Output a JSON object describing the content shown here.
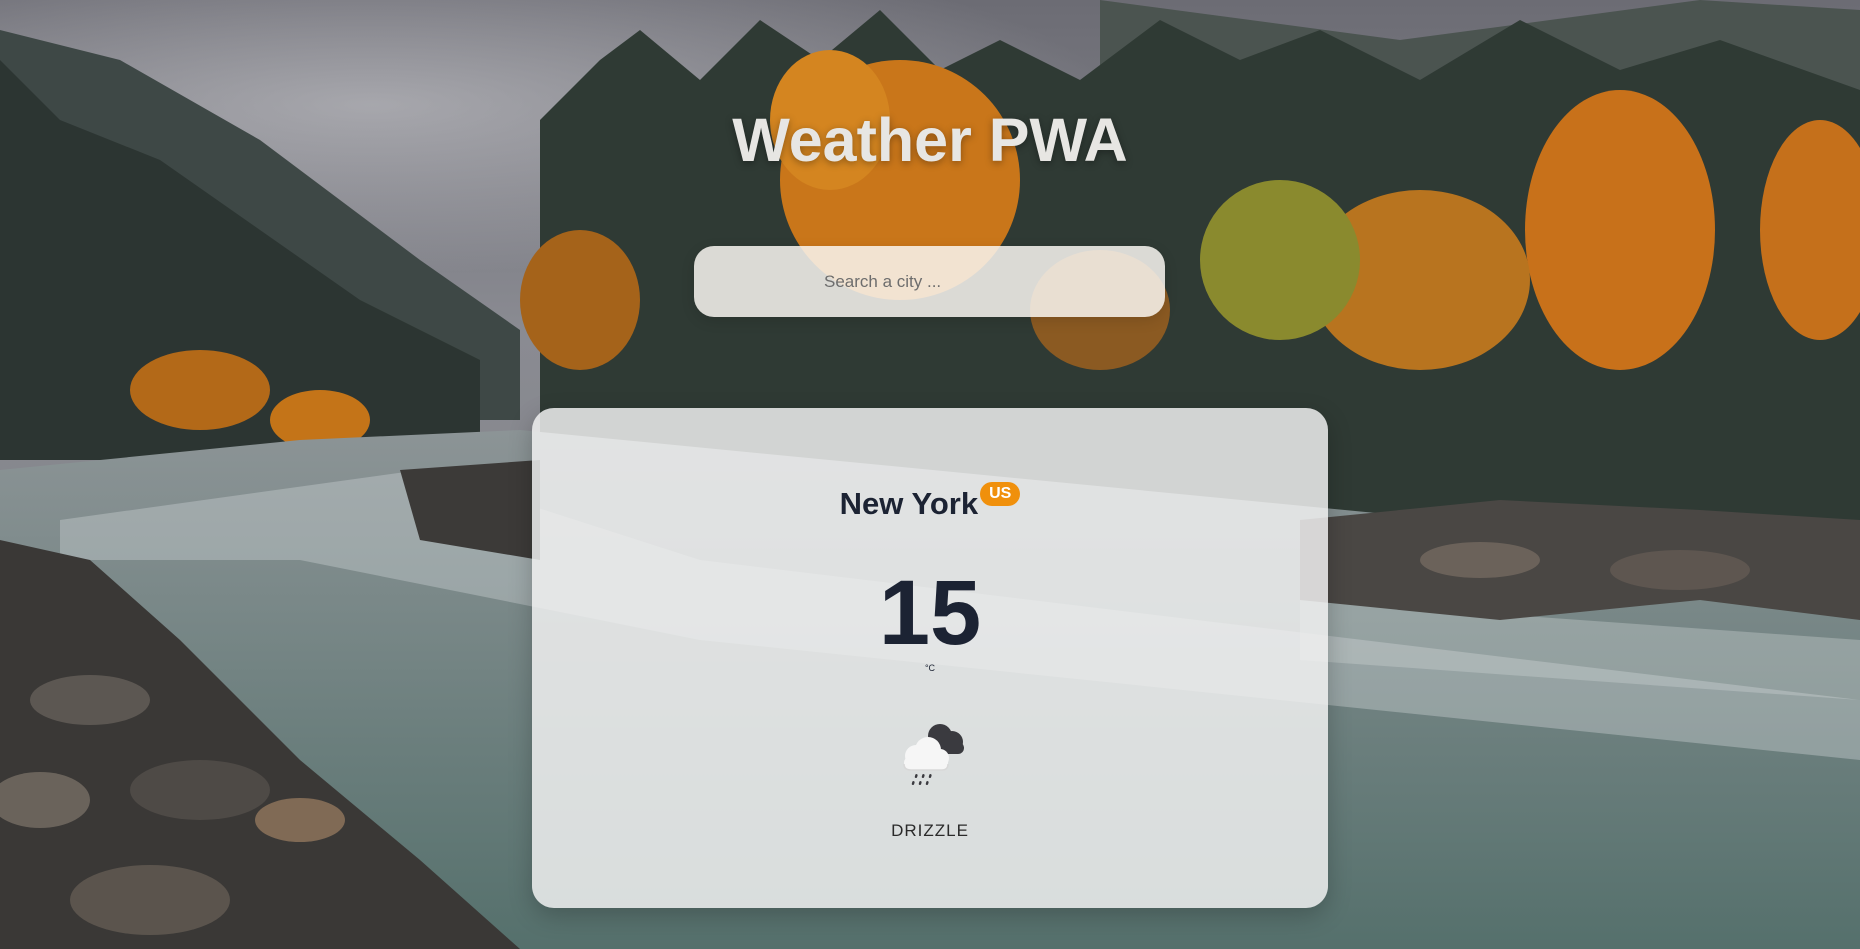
{
  "app": {
    "title": "Weather PWA"
  },
  "search": {
    "placeholder": "Search a city ...",
    "value": ""
  },
  "weather_card": {
    "city": "New York",
    "country_code": "US",
    "temperature": "15",
    "unit": "°C",
    "icon": "rain-cloud-icon",
    "condition": "DRIZZLE"
  },
  "colors": {
    "badge": "#f0900c",
    "text_dark": "#1c2333",
    "title": "#e7e6e3"
  },
  "background": {
    "description_icon": "forest-river-photo"
  }
}
